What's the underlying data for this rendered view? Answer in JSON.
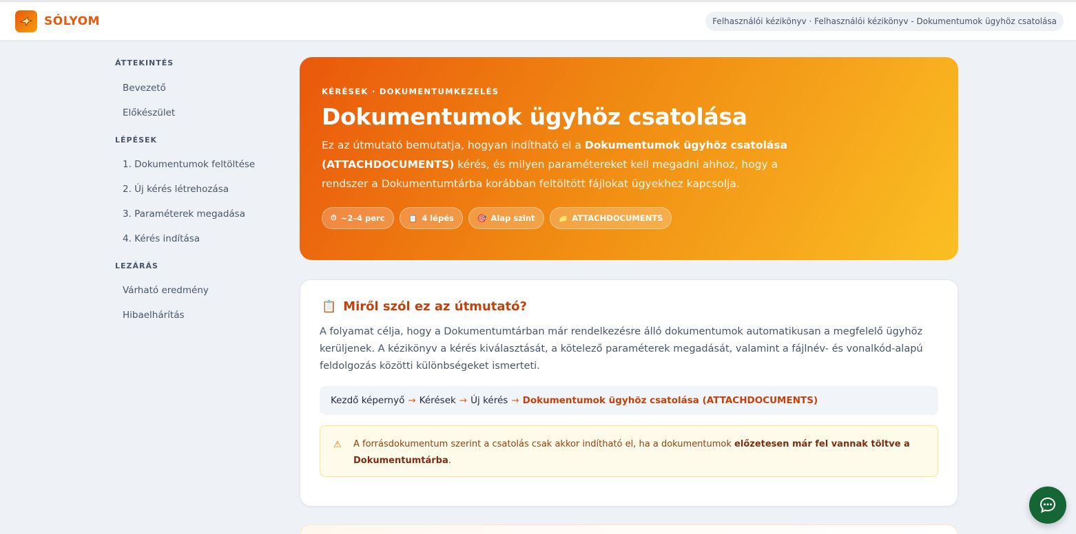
{
  "header": {
    "brand": "SÓLYOM",
    "logo_icon": "falcon-icon",
    "breadcrumb": "Felhasználói kézikönyv · Felhasználói kézikönyv - Dokumentumok ügyhöz csatolása"
  },
  "sidebar": {
    "sections": [
      {
        "title": "ÁTTEKINTÉS",
        "items": [
          "Bevezető",
          "Előkészület"
        ]
      },
      {
        "title": "LÉPÉSEK",
        "items": [
          "1. Dokumentumok feltöltése",
          "2. Új kérés létrehozása",
          "3. Paraméterek megadása",
          "4. Kérés indítása"
        ]
      },
      {
        "title": "LEZÁRÁS",
        "items": [
          "Várható eredmény",
          "Hibaelhárítás"
        ]
      }
    ]
  },
  "hero": {
    "eyebrow": "KÉRÉSEK · DOKUMENTUMKEZELÉS",
    "title": "Dokumentumok ügyhöz csatolása",
    "desc_pre": "Ez az útmutató bemutatja, hogyan indítható el a ",
    "desc_bold": "Dokumentumok ügyhöz csatolása (ATTACHDOCUMENTS)",
    "desc_post": " kérés, és milyen paramétereket kell megadni ahhoz, hogy a rendszer a Dokumentumtárba korábban feltöltött fájlokat ügyekhez kapcsolja.",
    "chips": [
      {
        "icon": "⏱",
        "label": "~2–4 perc"
      },
      {
        "icon": "📋",
        "label": "4 lépés"
      },
      {
        "icon": "🎯",
        "label": "Alap szint"
      },
      {
        "icon": "📁",
        "label": "ATTACHDOCUMENTS"
      }
    ]
  },
  "card": {
    "icon": "📋",
    "title": "Miről szól ez az útmutató?",
    "text": "A folyamat célja, hogy a Dokumentumtárban már rendelkezésre álló dokumentumok automatikusan a megfelelő ügyhöz kerüljenek. A kézikönyv a kérés kiválasztását, a kötelező paraméterek megadását, valamint a fájlnév- és vonalkód-alapú feldolgozás közötti különbségeket ismerteti.",
    "path": {
      "steps": [
        "Kezdő képernyő",
        "Kérések",
        "Új kérés"
      ],
      "arrow": "→",
      "target": "Dokumentumok ügyhöz csatolása (ATTACHDOCUMENTS)"
    },
    "warning": {
      "icon": "⚠",
      "pre": "A forrásdokumentum szerint a csatolás csak akkor indítható el, ha a dokumentumok ",
      "bold": "előzetesen már fel vannak töltve a Dokumentumtárba",
      "post": "."
    }
  },
  "chat": {
    "icon": "chat-bubble-icon"
  },
  "colors": {
    "accent": "#ea580c",
    "accent_dark": "#c2410c",
    "hero_end": "#fbbf24",
    "fab": "#166534",
    "background": "#eef1f6"
  }
}
